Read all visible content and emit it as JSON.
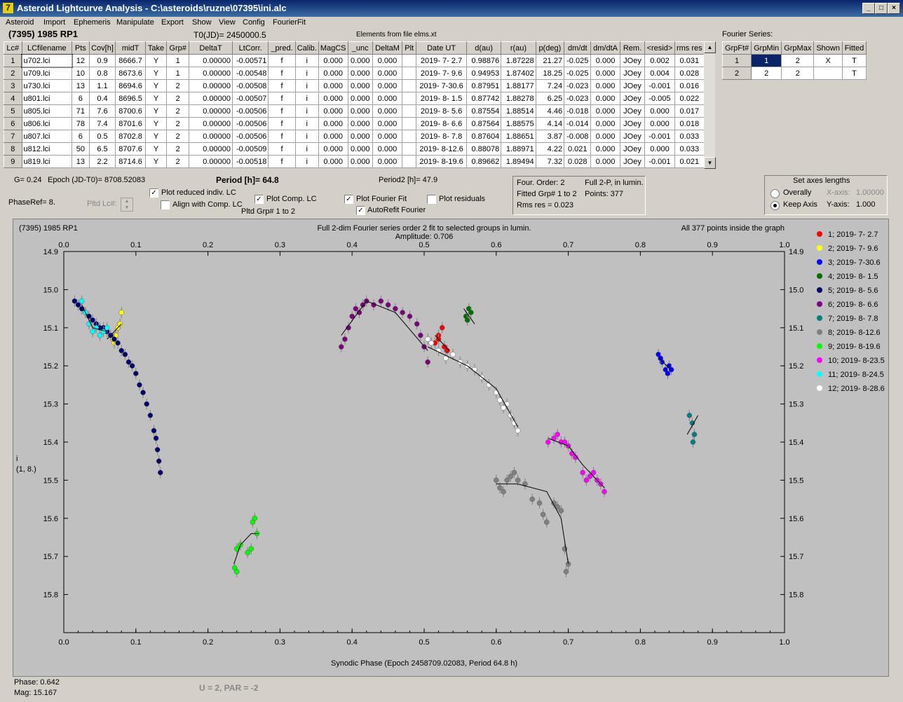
{
  "window": {
    "title": "Asteroid Lightcurve Analysis - C:\\asteroids\\ruzne\\07395\\ini.alc",
    "app_icon": "7"
  },
  "menu": [
    "Asteroid",
    "Import",
    "Ephemeris",
    "Manipulate",
    "Export",
    "Show",
    "View",
    "Config",
    "FourierFit"
  ],
  "header": {
    "object": "(7395) 1985 RP1",
    "t0": "T0(JD)= 2450000.5",
    "elements": "Elements from file elms.xt"
  },
  "table": {
    "columns": [
      "Lc#",
      "LCfilename",
      "Pts",
      "Cov[h]",
      "midT",
      "Take",
      "Grp#",
      "DeltaT",
      "LtCorr.",
      "_pred.",
      "Calib.",
      "MagCS",
      "_unc",
      "DeltaM",
      "Plt",
      "Date UT",
      "d(au)",
      "r(au)",
      "p(deg)",
      "dm/dt",
      "dm/dtA",
      "Rem.",
      "<resid>",
      "rms res"
    ],
    "rows": [
      [
        "1",
        "u702.lci",
        "12",
        "0.9",
        "8666.7",
        "Y",
        "1",
        "0.00000",
        "-0.00571",
        "f",
        "i",
        "0.000",
        "0.000",
        "0.000",
        "",
        "2019- 7- 2.7",
        "0.98876",
        "1.87228",
        "21.27",
        "-0.025",
        "0.000",
        "JOey",
        "0.002",
        "0.031"
      ],
      [
        "2",
        "u709.lci",
        "10",
        "0.8",
        "8673.6",
        "Y",
        "1",
        "0.00000",
        "-0.00548",
        "f",
        "i",
        "0.000",
        "0.000",
        "0.000",
        "",
        "2019- 7- 9.6",
        "0.94953",
        "1.87402",
        "18.25",
        "-0.025",
        "0.000",
        "JOey",
        "0.004",
        "0.028"
      ],
      [
        "3",
        "u730.lci",
        "13",
        "1.1",
        "8694.6",
        "Y",
        "2",
        "0.00000",
        "-0.00508",
        "f",
        "i",
        "0.000",
        "0.000",
        "0.000",
        "",
        "2019- 7-30.6",
        "0.87951",
        "1.88177",
        "7.24",
        "-0.023",
        "0.000",
        "JOey",
        "-0.001",
        "0.016"
      ],
      [
        "4",
        "u801.lci",
        "6",
        "0.4",
        "8696.5",
        "Y",
        "2",
        "0.00000",
        "-0.00507",
        "f",
        "i",
        "0.000",
        "0.000",
        "0.000",
        "",
        "2019- 8- 1.5",
        "0.87742",
        "1.88278",
        "6.25",
        "-0.023",
        "0.000",
        "JOey",
        "-0.005",
        "0.022"
      ],
      [
        "5",
        "u805.lci",
        "71",
        "7.6",
        "8700.6",
        "Y",
        "2",
        "0.00000",
        "-0.00506",
        "f",
        "i",
        "0.000",
        "0.000",
        "0.000",
        "",
        "2019- 8- 5.6",
        "0.87554",
        "1.88514",
        "4.46",
        "-0.018",
        "0.000",
        "JOey",
        "0.000",
        "0.017"
      ],
      [
        "6",
        "u806.lci",
        "78",
        "7.4",
        "8701.6",
        "Y",
        "2",
        "0.00000",
        "-0.00506",
        "f",
        "i",
        "0.000",
        "0.000",
        "0.000",
        "",
        "2019- 8- 6.6",
        "0.87564",
        "1.88575",
        "4.14",
        "-0.014",
        "0.000",
        "JOey",
        "0.000",
        "0.018"
      ],
      [
        "7",
        "u807.lci",
        "6",
        "0.5",
        "8702.8",
        "Y",
        "2",
        "0.00000",
        "-0.00506",
        "f",
        "i",
        "0.000",
        "0.000",
        "0.000",
        "",
        "2019- 8- 7.8",
        "0.87604",
        "1.88651",
        "3.87",
        "-0.008",
        "0.000",
        "JOey",
        "-0.001",
        "0.033"
      ],
      [
        "8",
        "u812.lci",
        "50",
        "6.5",
        "8707.6",
        "Y",
        "2",
        "0.00000",
        "-0.00509",
        "f",
        "i",
        "0.000",
        "0.000",
        "0.000",
        "",
        "2019- 8-12.6",
        "0.88078",
        "1.88971",
        "4.22",
        "0.021",
        "0.000",
        "JOey",
        "0.000",
        "0.033"
      ],
      [
        "9",
        "u819.lci",
        "13",
        "2.2",
        "8714.6",
        "Y",
        "2",
        "0.00000",
        "-0.00518",
        "f",
        "i",
        "0.000",
        "0.000",
        "0.000",
        "",
        "2019- 8-19.6",
        "0.89662",
        "1.89494",
        "7.32",
        "0.028",
        "0.000",
        "JOey",
        "-0.001",
        "0.021"
      ]
    ]
  },
  "fourier_series": {
    "label": "Fourier Series:",
    "columns": [
      "GrpFt#",
      "GrpMin",
      "GrpMax",
      "Shown",
      "Fitted"
    ],
    "rows": [
      [
        "1",
        "1",
        "2",
        "X",
        "T"
      ],
      [
        "2",
        "2",
        "2",
        "",
        "T"
      ]
    ]
  },
  "controls": {
    "g": "G= 0.24",
    "epoch": "Epoch (JD-T0)= 8708.52083",
    "period": "Period [h]= 64.8",
    "period2": "Period2 [h]= 47.9",
    "phaseref": "PhaseRef= 8.",
    "pltd_lc": "Pltd Lc#:",
    "plot_reduced": "Plot reduced indiv. LC",
    "align": "Align with Comp. LC",
    "plot_comp": "Plot Comp. LC",
    "pltd_grp": "Pltd Grp#  1   to   2",
    "plot_fourier": "Plot Fourier Fit",
    "autorefit": "AutoRefit Fourier",
    "plot_residuals": "Plot residuals",
    "four_order": "Four. Order:  2",
    "full2p": "Full 2-P, in lumin.",
    "fitted_grp": "Fitted Grp# 1 to 2",
    "points": "Points: 377",
    "rms": "Rms res      = 0.023",
    "axes_title": "Set axes lengths",
    "overally": "Overally",
    "keep_axis": "Keep Axis",
    "xaxis_label": "X-axis:",
    "xaxis_val": "1.00000",
    "yaxis_label": "Y-axis:",
    "yaxis_val": "1.000"
  },
  "status": {
    "phase": "Phase:  0.642",
    "mag": "Mag:    15.167",
    "upar": "U = 2, PAR = -2"
  },
  "chart_data": {
    "type": "scatter",
    "title_left": "(7395) 1985 RP1",
    "title_center": "Full 2-dim Fourier series order 2 fit to selected groups in lumin.",
    "amplitude": "Amplitude: 0.706",
    "title_right": "All 377 points inside the graph",
    "xlabel": "Synodic Phase (Epoch 2458709.02083, Period 64.8 h)",
    "ylabel": "i",
    "ylabel2": "(1, 8.)",
    "xlim": [
      0,
      1
    ],
    "ylim": [
      15.9,
      14.9
    ],
    "xticks": [
      "0.0",
      "0.1",
      "0.2",
      "0.3",
      "0.4",
      "0.5",
      "0.6",
      "0.7",
      "0.8",
      "0.9",
      "1.0"
    ],
    "yticks": [
      "14.9",
      "15.0",
      "15.1",
      "15.2",
      "15.3",
      "15.4",
      "15.5",
      "15.6",
      "15.7",
      "15.8"
    ],
    "series": [
      {
        "name": "1; 2019- 7- 2.7",
        "color": "#ff0000",
        "points": [
          [
            0.515,
            15.14
          ],
          [
            0.52,
            15.12
          ],
          [
            0.525,
            15.1
          ],
          [
            0.528,
            15.15
          ],
          [
            0.532,
            15.16
          ],
          [
            0.52,
            15.13
          ]
        ],
        "fit": [
          [
            0.515,
            15.12
          ],
          [
            0.535,
            15.16
          ]
        ]
      },
      {
        "name": "2; 2019- 7- 9.6",
        "color": "#ffff00",
        "points": [
          [
            0.068,
            15.13
          ],
          [
            0.072,
            15.12
          ],
          [
            0.075,
            15.1
          ],
          [
            0.078,
            15.09
          ],
          [
            0.08,
            15.06
          ],
          [
            0.07,
            15.14
          ]
        ],
        "fit": [
          [
            0.06,
            15.13
          ],
          [
            0.08,
            15.09
          ]
        ]
      },
      {
        "name": "3; 2019- 7-30.6",
        "color": "#0000ff",
        "points": [
          [
            0.825,
            15.17
          ],
          [
            0.83,
            15.19
          ],
          [
            0.835,
            15.21
          ],
          [
            0.84,
            15.2
          ],
          [
            0.838,
            15.22
          ],
          [
            0.843,
            15.21
          ],
          [
            0.828,
            15.18
          ]
        ],
        "fit": [
          [
            0.826,
            15.18
          ],
          [
            0.842,
            15.21
          ]
        ]
      },
      {
        "name": "4; 2019- 8- 1.5",
        "color": "#007000",
        "points": [
          [
            0.558,
            15.07
          ],
          [
            0.562,
            15.05
          ],
          [
            0.565,
            15.06
          ],
          [
            0.56,
            15.08
          ]
        ],
        "fit": [
          [
            0.555,
            15.05
          ],
          [
            0.57,
            15.09
          ]
        ]
      },
      {
        "name": "5; 2019- 8- 5.6",
        "color": "#000070",
        "points": [
          [
            0.015,
            15.03
          ],
          [
            0.02,
            15.04
          ],
          [
            0.025,
            15.05
          ],
          [
            0.03,
            15.06
          ],
          [
            0.035,
            15.07
          ],
          [
            0.04,
            15.08
          ],
          [
            0.045,
            15.09
          ],
          [
            0.05,
            15.1
          ],
          [
            0.055,
            15.1
          ],
          [
            0.06,
            15.11
          ],
          [
            0.065,
            15.12
          ],
          [
            0.07,
            15.13
          ],
          [
            0.075,
            15.14
          ],
          [
            0.08,
            15.16
          ],
          [
            0.085,
            15.17
          ],
          [
            0.09,
            15.19
          ],
          [
            0.095,
            15.2
          ],
          [
            0.1,
            15.22
          ],
          [
            0.105,
            15.25
          ],
          [
            0.11,
            15.27
          ],
          [
            0.115,
            15.3
          ],
          [
            0.12,
            15.33
          ],
          [
            0.125,
            15.37
          ],
          [
            0.128,
            15.39
          ],
          [
            0.13,
            15.42
          ],
          [
            0.132,
            15.45
          ],
          [
            0.134,
            15.48
          ]
        ],
        "fit": []
      },
      {
        "name": "6; 2019- 8- 6.6",
        "color": "#800080",
        "points": [
          [
            0.385,
            15.15
          ],
          [
            0.39,
            15.13
          ],
          [
            0.395,
            15.1
          ],
          [
            0.4,
            15.07
          ],
          [
            0.405,
            15.05
          ],
          [
            0.41,
            15.06
          ],
          [
            0.415,
            15.04
          ],
          [
            0.42,
            15.03
          ],
          [
            0.43,
            15.04
          ],
          [
            0.44,
            15.03
          ],
          [
            0.45,
            15.04
          ],
          [
            0.46,
            15.05
          ],
          [
            0.47,
            15.06
          ],
          [
            0.48,
            15.07
          ],
          [
            0.49,
            15.09
          ],
          [
            0.495,
            15.12
          ],
          [
            0.5,
            15.15
          ],
          [
            0.505,
            15.19
          ]
        ],
        "fit": [
          [
            0.385,
            15.12
          ],
          [
            0.42,
            15.03
          ],
          [
            0.46,
            15.06
          ],
          [
            0.505,
            15.16
          ]
        ]
      },
      {
        "name": "7; 2019- 8- 7.8",
        "color": "#008080",
        "points": [
          [
            0.868,
            15.33
          ],
          [
            0.872,
            15.35
          ],
          [
            0.875,
            15.38
          ],
          [
            0.873,
            15.4
          ]
        ],
        "fit": [
          [
            0.865,
            15.38
          ],
          [
            0.88,
            15.33
          ]
        ]
      },
      {
        "name": "8; 2019- 8-12.6",
        "color": "#808080",
        "points": [
          [
            0.6,
            15.5
          ],
          [
            0.605,
            15.52
          ],
          [
            0.61,
            15.53
          ],
          [
            0.615,
            15.5
          ],
          [
            0.62,
            15.49
          ],
          [
            0.625,
            15.48
          ],
          [
            0.63,
            15.5
          ],
          [
            0.64,
            15.51
          ],
          [
            0.65,
            15.55
          ],
          [
            0.66,
            15.56
          ],
          [
            0.665,
            15.59
          ],
          [
            0.67,
            15.61
          ],
          [
            0.68,
            15.56
          ],
          [
            0.685,
            15.57
          ],
          [
            0.69,
            15.58
          ],
          [
            0.695,
            15.68
          ],
          [
            0.7,
            15.72
          ],
          [
            0.697,
            15.74
          ]
        ],
        "fit": [
          [
            0.6,
            15.51
          ],
          [
            0.63,
            15.51
          ],
          [
            0.67,
            15.53
          ],
          [
            0.69,
            15.6
          ],
          [
            0.7,
            15.72
          ]
        ]
      },
      {
        "name": "9; 2019- 8-19.6",
        "color": "#00ff00",
        "points": [
          [
            0.237,
            15.73
          ],
          [
            0.24,
            15.74
          ],
          [
            0.24,
            15.68
          ],
          [
            0.245,
            15.67
          ],
          [
            0.255,
            15.69
          ],
          [
            0.26,
            15.68
          ],
          [
            0.262,
            15.61
          ],
          [
            0.265,
            15.6
          ],
          [
            0.268,
            15.64
          ]
        ],
        "fit": [
          [
            0.236,
            15.72
          ],
          [
            0.245,
            15.67
          ],
          [
            0.26,
            15.64
          ],
          [
            0.27,
            15.64
          ]
        ]
      },
      {
        "name": "10; 2019- 8-23.5",
        "color": "#ff00ff",
        "points": [
          [
            0.672,
            15.4
          ],
          [
            0.68,
            15.39
          ],
          [
            0.685,
            15.38
          ],
          [
            0.69,
            15.4
          ],
          [
            0.695,
            15.4
          ],
          [
            0.7,
            15.41
          ],
          [
            0.705,
            15.43
          ],
          [
            0.71,
            15.44
          ],
          [
            0.72,
            15.48
          ],
          [
            0.725,
            15.5
          ],
          [
            0.73,
            15.49
          ],
          [
            0.735,
            15.48
          ],
          [
            0.74,
            15.5
          ],
          [
            0.745,
            15.51
          ],
          [
            0.75,
            15.53
          ]
        ],
        "fit": [
          [
            0.672,
            15.39
          ],
          [
            0.7,
            15.41
          ],
          [
            0.72,
            15.46
          ],
          [
            0.75,
            15.52
          ]
        ]
      },
      {
        "name": "11; 2019- 8-24.5",
        "color": "#00ffff",
        "points": [
          [
            0.025,
            15.03
          ],
          [
            0.03,
            15.06
          ],
          [
            0.035,
            15.09
          ],
          [
            0.04,
            15.11
          ],
          [
            0.045,
            15.1
          ],
          [
            0.05,
            15.12
          ],
          [
            0.055,
            15.11
          ],
          [
            0.06,
            15.1
          ]
        ],
        "fit": [
          [
            0.025,
            15.04
          ],
          [
            0.04,
            15.1
          ],
          [
            0.06,
            15.11
          ]
        ]
      },
      {
        "name": "12; 2019- 8-28.6",
        "color": "#ffffff",
        "points": [
          [
            0.505,
            15.13
          ],
          [
            0.51,
            15.14
          ],
          [
            0.52,
            15.16
          ],
          [
            0.53,
            15.18
          ],
          [
            0.54,
            15.17
          ],
          [
            0.55,
            15.19
          ],
          [
            0.56,
            15.2
          ],
          [
            0.57,
            15.21
          ],
          [
            0.58,
            15.23
          ],
          [
            0.59,
            15.25
          ],
          [
            0.6,
            15.27
          ],
          [
            0.605,
            15.29
          ],
          [
            0.61,
            15.31
          ],
          [
            0.615,
            15.3
          ],
          [
            0.62,
            15.33
          ],
          [
            0.625,
            15.35
          ],
          [
            0.63,
            15.37
          ]
        ],
        "fit": [
          [
            0.505,
            15.15
          ],
          [
            0.56,
            15.2
          ],
          [
            0.6,
            15.26
          ],
          [
            0.63,
            15.36
          ]
        ]
      }
    ]
  }
}
